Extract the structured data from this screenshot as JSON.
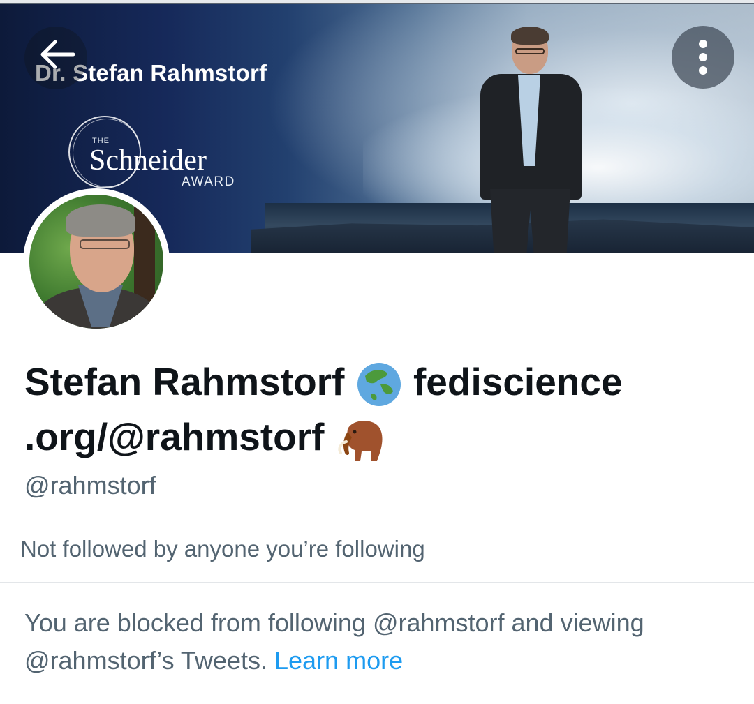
{
  "banner": {
    "title": "Dr. Stefan Rahmstorf",
    "award_prefix": "THE",
    "award_name": "Schneider",
    "award_suffix": "AWARD"
  },
  "header": {
    "back_icon": "arrow-left-icon",
    "more_icon": "more-vertical-icon"
  },
  "profile": {
    "display_name_part1": "Stefan Rahmstorf",
    "display_name_emoji1": "globe-asia-icon",
    "display_name_part2": "fediscience .org/@rahmstorf",
    "display_name_emoji2": "mammoth-icon",
    "handle": "@rahmstorf",
    "follow_info": "Not followed by anyone you’re following"
  },
  "blocked": {
    "message": "You are blocked from following @rahmstorf and viewing @rahmstorf’s Tweets.",
    "link_label": "Learn more"
  },
  "colors": {
    "text_primary": "#0f1419",
    "text_secondary": "#536471",
    "link": "#1d9bf0",
    "divider": "#e3e6e9"
  }
}
